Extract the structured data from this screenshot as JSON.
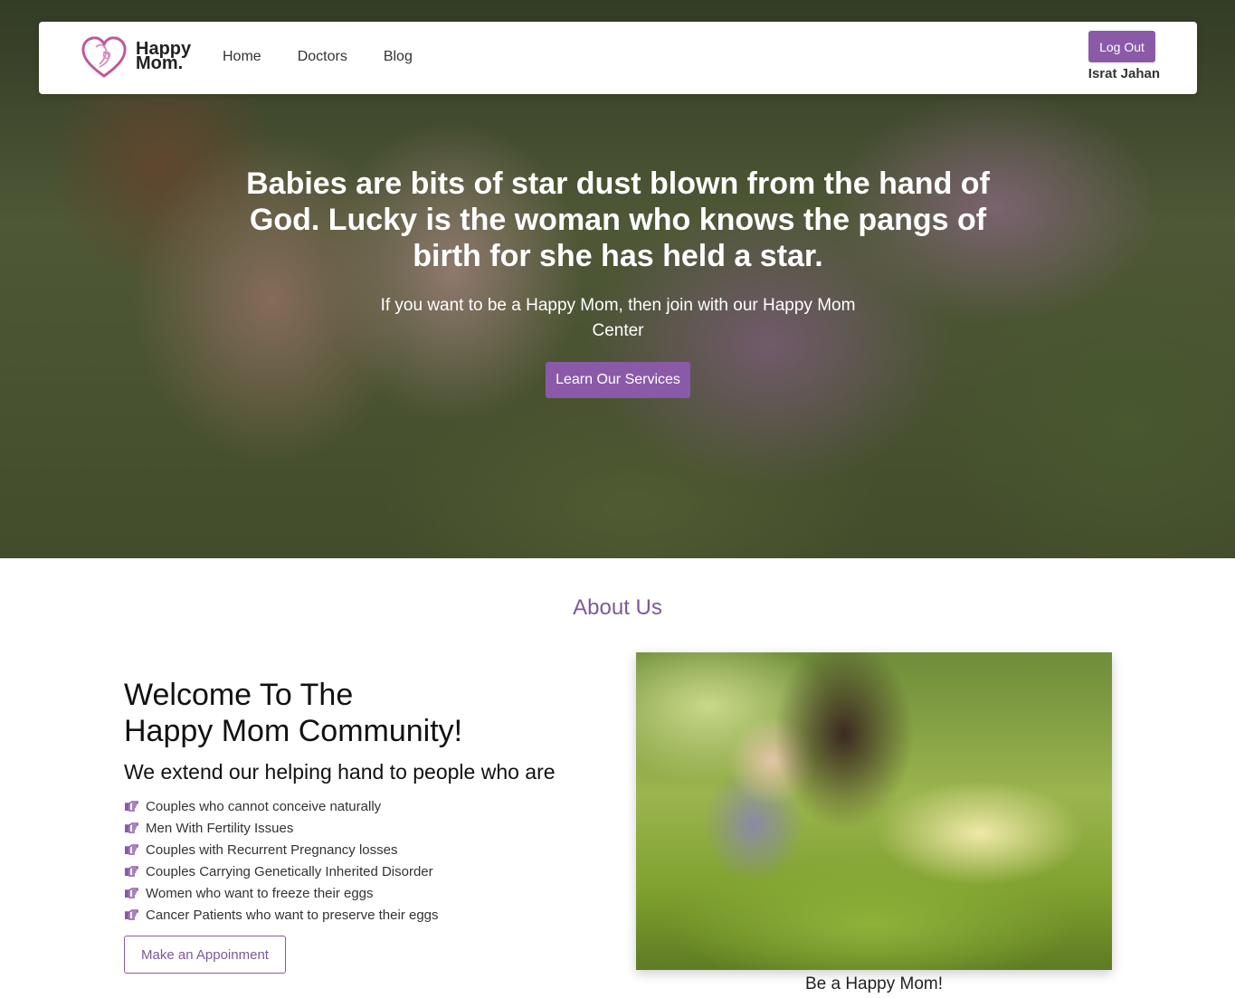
{
  "colors": {
    "accent": "#8a5aa8",
    "about_title": "#7b5a9a"
  },
  "brand": {
    "line1": "Happy",
    "line2": "Mom.",
    "icon": "heart-mother-baby-logo"
  },
  "nav": {
    "items": [
      {
        "label": "Home"
      },
      {
        "label": "Doctors"
      },
      {
        "label": "Blog"
      }
    ]
  },
  "user": {
    "logout_label": "Log Out",
    "name": "Israt Jahan"
  },
  "hero": {
    "quote": "Babies are bits of star dust blown from the hand of God. Lucky is the woman who knows the pangs of birth for she has held a star.",
    "subtitle": "If you want to be a Happy Mom, then join with our Happy Mom Center",
    "button_label": "Learn Our Services"
  },
  "about": {
    "title": "About Us",
    "welcome_line1": "Welcome To The",
    "welcome_line2": "Happy Mom Community!",
    "extend": "We extend our helping hand to people who are",
    "list": [
      "Couples who cannot conceive naturally",
      "Men With Fertility Issues",
      "Couples with Recurrent Pregnancy losses",
      "Couples Carrying Genetically Inherited Disorder",
      "Women who want to freeze their eggs",
      "Cancer Patients who want to preserve their eggs"
    ],
    "list_icon": "hand-pointing-right-icon",
    "appointment_label": "Make an Appoinment",
    "image_caption": "Be a Happy Mom!"
  }
}
